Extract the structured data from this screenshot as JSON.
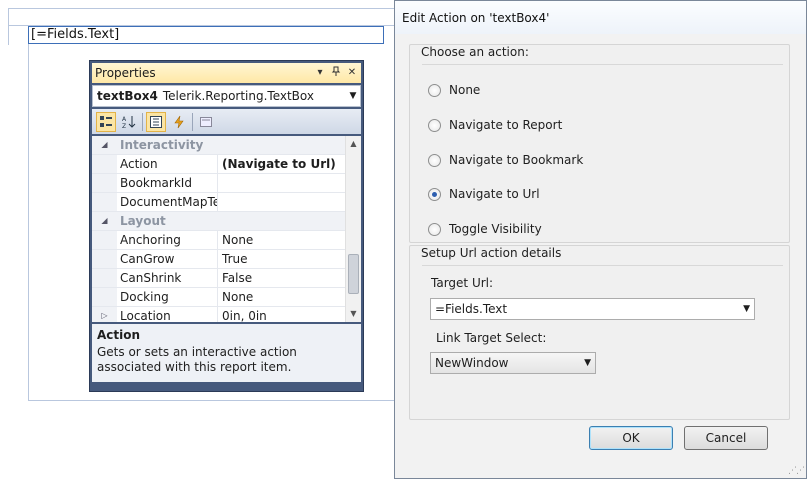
{
  "designer": {
    "textbox_expression": "[=Fields.Text]"
  },
  "properties": {
    "title": "Properties",
    "title_buttons": [
      "▾",
      "📌",
      "✕"
    ],
    "object_name": "textBox4",
    "object_type": "Telerik.Reporting.TextBox",
    "rows": [
      {
        "kind": "category",
        "name": "Interactivity"
      },
      {
        "kind": "prop",
        "name": "Action",
        "value": "(Navigate to Url)",
        "bold": true
      },
      {
        "kind": "prop",
        "name": "BookmarkId",
        "value": ""
      },
      {
        "kind": "prop",
        "name": "DocumentMapText",
        "value": ""
      },
      {
        "kind": "category",
        "name": "Layout"
      },
      {
        "kind": "prop",
        "name": "Anchoring",
        "value": "None"
      },
      {
        "kind": "prop",
        "name": "CanGrow",
        "value": "True"
      },
      {
        "kind": "prop",
        "name": "CanShrink",
        "value": "False"
      },
      {
        "kind": "prop",
        "name": "Docking",
        "value": "None"
      },
      {
        "kind": "prop",
        "name": "Location",
        "value": "0in, 0in",
        "expandable": true
      }
    ],
    "description_title": "Action",
    "description_text": "Gets or sets an interactive action associated with this report item."
  },
  "dialog": {
    "title": "Edit Action on 'textBox4'",
    "action_group_title": "Choose an action:",
    "actions": [
      {
        "label": "None",
        "checked": false
      },
      {
        "label": "Navigate to Report",
        "checked": false
      },
      {
        "label": "Navigate to Bookmark",
        "checked": false
      },
      {
        "label": "Navigate to Url",
        "checked": true
      },
      {
        "label": "Toggle Visibility",
        "checked": false
      }
    ],
    "url_group_title": "Setup Url action details",
    "target_url_label": "Target Url:",
    "target_url_value": "=Fields.Text",
    "link_target_label": "Link Target Select:",
    "link_target_value": "NewWindow",
    "ok_label": "OK",
    "cancel_label": "Cancel"
  }
}
